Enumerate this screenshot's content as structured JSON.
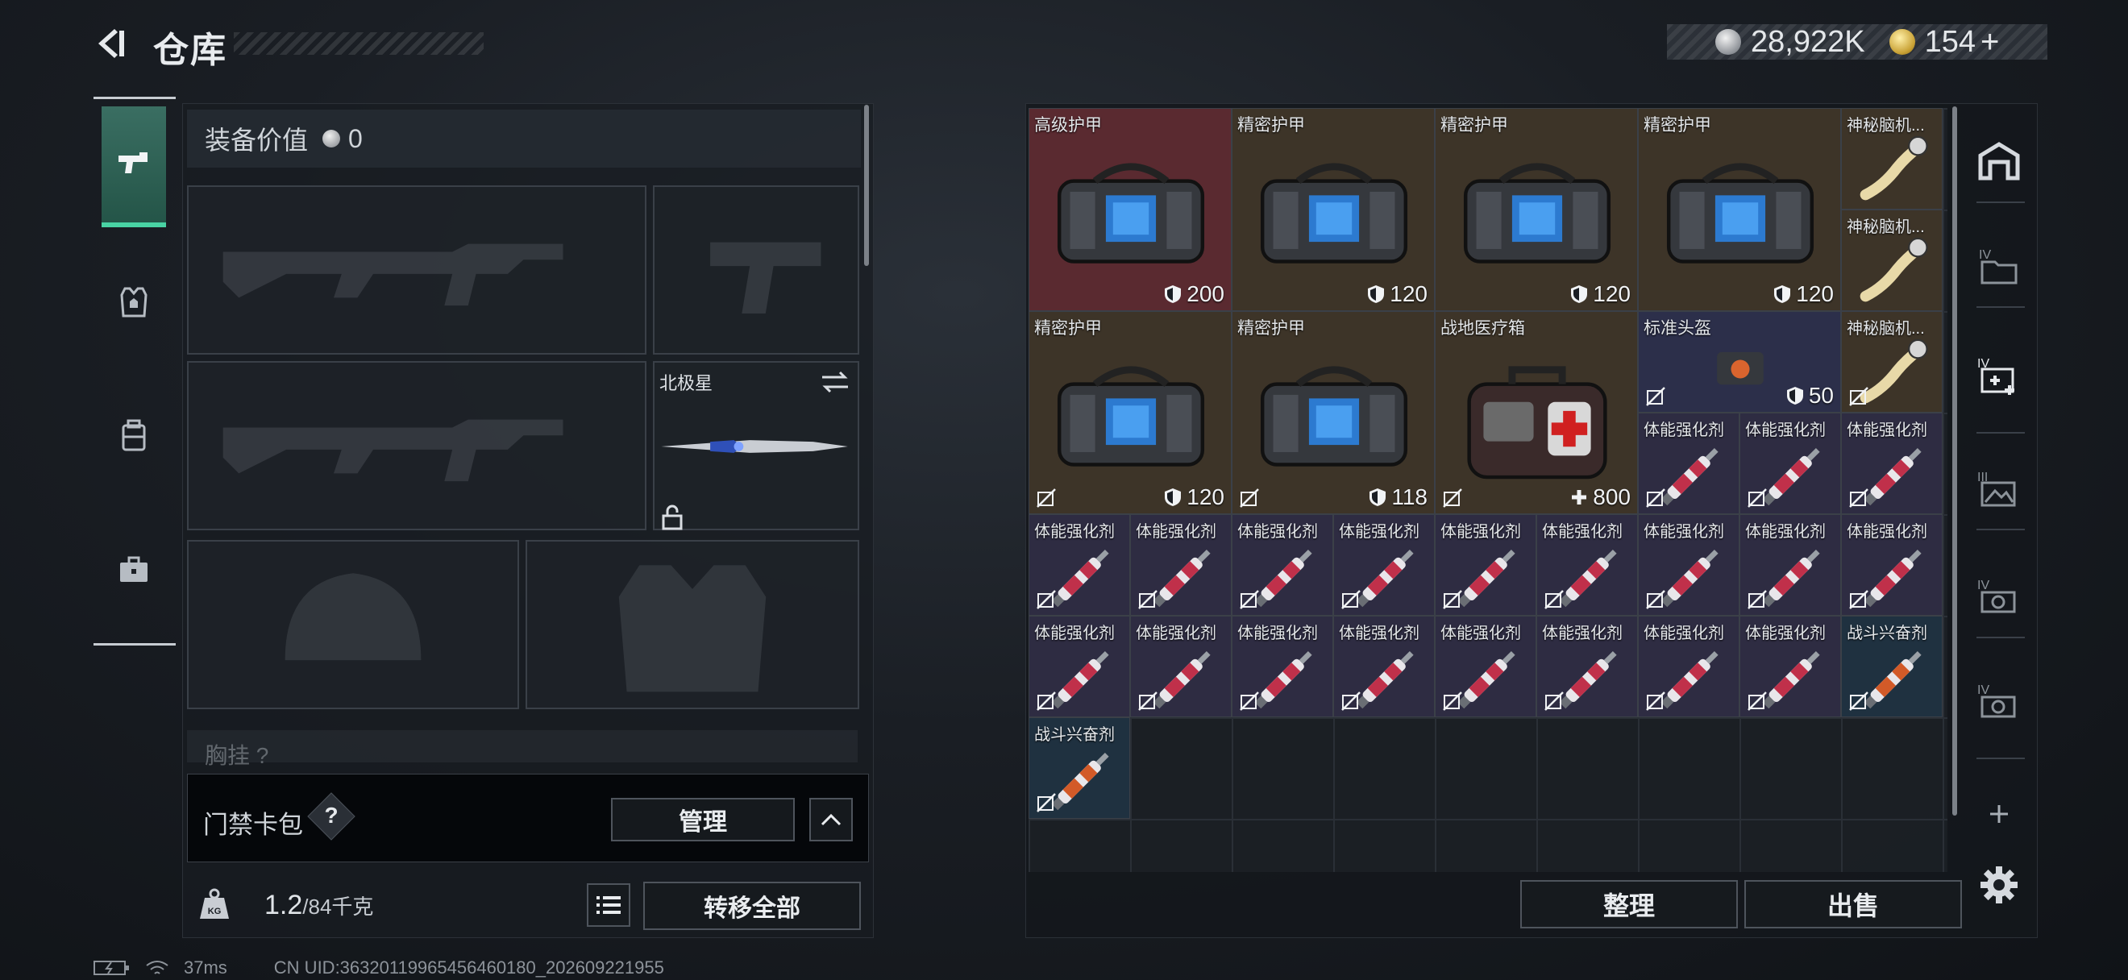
{
  "header": {
    "title": "仓库",
    "currency_silver": "28,922K",
    "currency_gold": "154",
    "plus": "+"
  },
  "left_panel": {
    "equip_value_label": "装备价值",
    "equip_value": "0",
    "melee_slot_label": "北极星",
    "chest_rig_label": "胸挂",
    "chest_rig_suffix": "?",
    "card_pack_label": "门禁卡包",
    "help_mark": "?",
    "manage_button": "管理",
    "weight_current": "1.2",
    "weight_max": "/84千克",
    "transfer_all_button": "转移全部"
  },
  "inventory": {
    "items": [
      {
        "label": "高级护甲",
        "value": "200",
        "value_icon": "shield-icon",
        "art": "armor-bag",
        "bg": "#5a2a30",
        "col": 0,
        "row": 0,
        "w": 1,
        "h": 1
      },
      {
        "label": "精密护甲",
        "value": "120",
        "value_icon": "shield-icon",
        "art": "armor-bag",
        "bg": "#3d3428",
        "col": 1,
        "row": 0,
        "w": 1,
        "h": 1
      },
      {
        "label": "精密护甲",
        "value": "120",
        "value_icon": "shield-icon",
        "art": "armor-bag",
        "bg": "#3d3428",
        "col": 2,
        "row": 0,
        "w": 1,
        "h": 1
      },
      {
        "label": "精密护甲",
        "value": "120",
        "value_icon": "shield-icon",
        "art": "armor-bag",
        "bg": "#3d3428",
        "col": 3,
        "row": 0,
        "w": 1,
        "h": 1
      },
      {
        "label": "神秘脑机...",
        "value": "",
        "value_icon": "",
        "art": "brain-chip",
        "bg": "#3d3428",
        "col": 4,
        "row": 0,
        "w": 0.5,
        "h": 0.5
      },
      {
        "label": "神秘脑机...",
        "value": "",
        "value_icon": "",
        "art": "brain-chip",
        "bg": "#3d3428",
        "col": 4,
        "row": 0.5,
        "w": 0.5,
        "h": 0.5
      },
      {
        "label": "精密护甲",
        "value": "120",
        "value_icon": "shield-icon",
        "art": "armor-bag",
        "bg": "#3d3428",
        "col": 0,
        "row": 1,
        "w": 1,
        "h": 1
      },
      {
        "label": "精密护甲",
        "value": "118",
        "value_icon": "shield-icon",
        "art": "armor-bag",
        "bg": "#3d3428",
        "col": 1,
        "row": 1,
        "w": 1,
        "h": 1
      },
      {
        "label": "战地医疗箱",
        "value": "800",
        "value_icon": "plus-icon",
        "art": "medkit",
        "bg": "#3d3428",
        "col": 2,
        "row": 1,
        "w": 1,
        "h": 1
      },
      {
        "label": "标准头盔",
        "value": "50",
        "value_icon": "shield-icon",
        "art": "helmet-bag",
        "bg": "#2c2f4a",
        "col": 3,
        "row": 1,
        "w": 1,
        "h": 0.5
      },
      {
        "label": "神秘脑机...",
        "value": "",
        "value_icon": "",
        "art": "brain-chip",
        "bg": "#3d3428",
        "col": 4,
        "row": 1,
        "w": 0.5,
        "h": 0.5
      },
      {
        "label": "体能强化剂",
        "value": "",
        "value_icon": "",
        "art": "syringe-red",
        "bg": "#2e2c42",
        "col": 3,
        "row": 1.5,
        "w": 0.5,
        "h": 0.5
      },
      {
        "label": "体能强化剂",
        "value": "",
        "value_icon": "",
        "art": "syringe-red",
        "bg": "#2e2c42",
        "col": 3.5,
        "row": 1.5,
        "w": 0.5,
        "h": 0.5
      },
      {
        "label": "体能强化剂",
        "value": "",
        "value_icon": "",
        "art": "syringe-red",
        "bg": "#2e2c42",
        "col": 4,
        "row": 1.5,
        "w": 0.5,
        "h": 0.5
      },
      {
        "label": "体能强化剂",
        "value": "",
        "value_icon": "",
        "art": "syringe-red",
        "bg": "#2e2c42",
        "col": 0,
        "row": 2,
        "w": 0.5,
        "h": 0.5
      },
      {
        "label": "体能强化剂",
        "value": "",
        "value_icon": "",
        "art": "syringe-red",
        "bg": "#2e2c42",
        "col": 0.5,
        "row": 2,
        "w": 0.5,
        "h": 0.5
      },
      {
        "label": "体能强化剂",
        "value": "",
        "value_icon": "",
        "art": "syringe-red",
        "bg": "#2e2c42",
        "col": 1,
        "row": 2,
        "w": 0.5,
        "h": 0.5
      },
      {
        "label": "体能强化剂",
        "value": "",
        "value_icon": "",
        "art": "syringe-red",
        "bg": "#2e2c42",
        "col": 1.5,
        "row": 2,
        "w": 0.5,
        "h": 0.5
      },
      {
        "label": "体能强化剂",
        "value": "",
        "value_icon": "",
        "art": "syringe-red",
        "bg": "#2e2c42",
        "col": 2,
        "row": 2,
        "w": 0.5,
        "h": 0.5
      },
      {
        "label": "体能强化剂",
        "value": "",
        "value_icon": "",
        "art": "syringe-red",
        "bg": "#2e2c42",
        "col": 2.5,
        "row": 2,
        "w": 0.5,
        "h": 0.5
      },
      {
        "label": "体能强化剂",
        "value": "",
        "value_icon": "",
        "art": "syringe-red",
        "bg": "#2e2c42",
        "col": 3,
        "row": 2,
        "w": 0.5,
        "h": 0.5
      },
      {
        "label": "体能强化剂",
        "value": "",
        "value_icon": "",
        "art": "syringe-red",
        "bg": "#2e2c42",
        "col": 3.5,
        "row": 2,
        "w": 0.5,
        "h": 0.5
      },
      {
        "label": "体能强化剂",
        "value": "",
        "value_icon": "",
        "art": "syringe-red",
        "bg": "#2e2c42",
        "col": 4,
        "row": 2,
        "w": 0.5,
        "h": 0.5
      },
      {
        "label": "体能强化剂",
        "value": "",
        "value_icon": "",
        "art": "syringe-red",
        "bg": "#2e2c42",
        "col": 0,
        "row": 2.5,
        "w": 0.5,
        "h": 0.5
      },
      {
        "label": "体能强化剂",
        "value": "",
        "value_icon": "",
        "art": "syringe-red",
        "bg": "#2e2c42",
        "col": 0.5,
        "row": 2.5,
        "w": 0.5,
        "h": 0.5
      },
      {
        "label": "体能强化剂",
        "value": "",
        "value_icon": "",
        "art": "syringe-red",
        "bg": "#2e2c42",
        "col": 1,
        "row": 2.5,
        "w": 0.5,
        "h": 0.5
      },
      {
        "label": "体能强化剂",
        "value": "",
        "value_icon": "",
        "art": "syringe-red",
        "bg": "#2e2c42",
        "col": 1.5,
        "row": 2.5,
        "w": 0.5,
        "h": 0.5
      },
      {
        "label": "体能强化剂",
        "value": "",
        "value_icon": "",
        "art": "syringe-red",
        "bg": "#2e2c42",
        "col": 2,
        "row": 2.5,
        "w": 0.5,
        "h": 0.5
      },
      {
        "label": "体能强化剂",
        "value": "",
        "value_icon": "",
        "art": "syringe-red",
        "bg": "#2e2c42",
        "col": 2.5,
        "row": 2.5,
        "w": 0.5,
        "h": 0.5
      },
      {
        "label": "体能强化剂",
        "value": "",
        "value_icon": "",
        "art": "syringe-red",
        "bg": "#2e2c42",
        "col": 3,
        "row": 2.5,
        "w": 0.5,
        "h": 0.5
      },
      {
        "label": "体能强化剂",
        "value": "",
        "value_icon": "",
        "art": "syringe-red",
        "bg": "#2e2c42",
        "col": 3.5,
        "row": 2.5,
        "w": 0.5,
        "h": 0.5
      },
      {
        "label": "战斗兴奋剂",
        "value": "",
        "value_icon": "",
        "art": "syringe-orange",
        "bg": "#1f3140",
        "col": 4,
        "row": 2.5,
        "w": 0.5,
        "h": 0.5
      },
      {
        "label": "战斗兴奋剂",
        "value": "",
        "value_icon": "",
        "art": "syringe-orange",
        "bg": "#1f3140",
        "col": 0,
        "row": 3,
        "w": 0.5,
        "h": 0.5
      }
    ],
    "sort_button": "整理",
    "sell_button": "出售"
  },
  "status_bar": {
    "ping": "37ms",
    "uid": "CN UID:3632011996545646018​0_202609221955"
  }
}
